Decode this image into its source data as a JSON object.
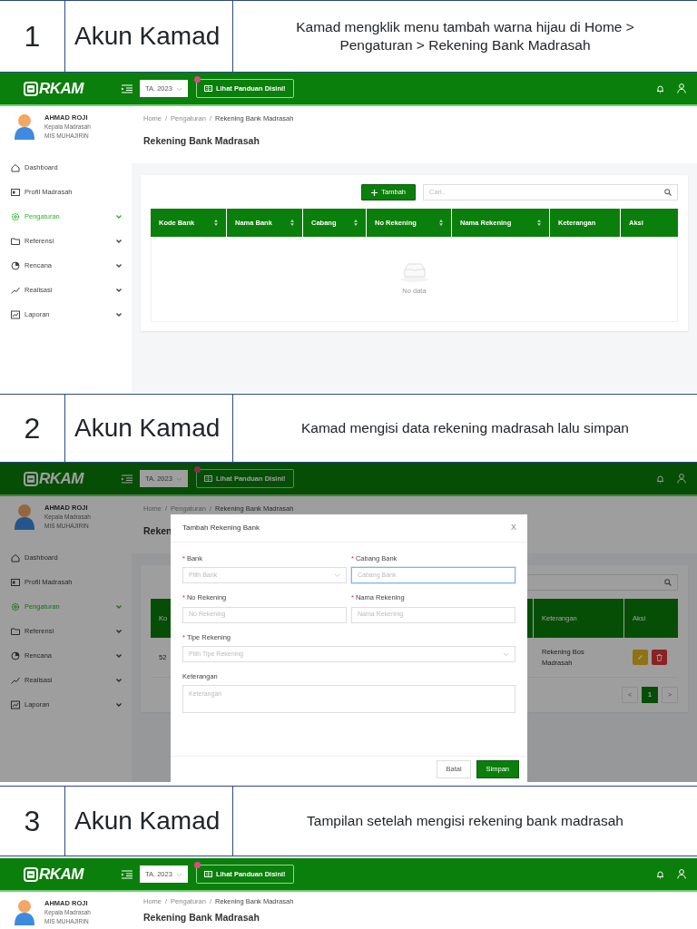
{
  "steps": [
    {
      "number": "1",
      "account": "Akun Kamad",
      "description": "Kamad mengklik menu tambah warna hijau di Home > Pengaturan > Rekening Bank Madrasah",
      "screen": {
        "navbar": {
          "logo": "RKAM",
          "year": "TA. 2023",
          "guide_button": "Lihat Panduan Disini!"
        },
        "user": {
          "name": "AHMAD ROJI",
          "role": "Kepala Madrasah",
          "school": "MIS MUHAJIRIN"
        },
        "sidebar": {
          "items": [
            {
              "label": "Dashboard",
              "selected": false,
              "expandable": false
            },
            {
              "label": "Profil Madrasah",
              "selected": false,
              "expandable": false
            },
            {
              "label": "Pengaturan",
              "selected": true,
              "expandable": true
            },
            {
              "label": "Referensi",
              "selected": false,
              "expandable": true
            },
            {
              "label": "Rencana",
              "selected": false,
              "expandable": true
            },
            {
              "label": "Realisasi",
              "selected": false,
              "expandable": true
            },
            {
              "label": "Laporan",
              "selected": false,
              "expandable": true
            }
          ]
        },
        "breadcrumb": [
          "Home",
          "Pengaturan",
          "Rekening Bank Madrasah"
        ],
        "breadcrumb_separators": [
          "/",
          "/"
        ],
        "page_title": "Rekening Bank Madrasah",
        "content": {
          "kind": "table",
          "add_button": "Tambah",
          "search_placeholder": "Cari..",
          "columns": [
            {
              "label": "Kode Bank",
              "sortable": true
            },
            {
              "label": "Nama Bank",
              "sortable": true
            },
            {
              "label": "Cabang",
              "sortable": true
            },
            {
              "label": "No Rekening",
              "sortable": true
            },
            {
              "label": "Nama Rekening",
              "sortable": true
            },
            {
              "label": "Keterangan",
              "sortable": false
            },
            {
              "label": "Aksi",
              "sortable": false
            }
          ],
          "empty_text": "No data"
        }
      }
    },
    {
      "number": "2",
      "account": "Akun Kamad",
      "description": "Kamad mengisi data rekening madrasah lalu simpan",
      "screen": {
        "navbar": {
          "logo": "RKAM",
          "year": "TA. 2023",
          "guide_button": "Lihat Panduan Disini!"
        },
        "user": {
          "name": "AHMAD ROJI",
          "role": "Kepala Madrasah",
          "school": "MIS MUHAJIRIN"
        },
        "sidebar": {
          "items": [
            {
              "label": "Dashboard",
              "selected": false,
              "expandable": false
            },
            {
              "label": "Profil Madrasah",
              "selected": false,
              "expandable": false
            },
            {
              "label": "Pengaturan",
              "selected": true,
              "expandable": true
            },
            {
              "label": "Referensi",
              "selected": false,
              "expandable": true
            },
            {
              "label": "Rencana",
              "selected": false,
              "expandable": true
            },
            {
              "label": "Realisasi",
              "selected": false,
              "expandable": true
            },
            {
              "label": "Laporan",
              "selected": false,
              "expandable": true
            }
          ]
        },
        "breadcrumb": [
          "Home",
          "Pengaturan",
          "Rekening Bank Madrasah"
        ],
        "breadcrumb_separators": [
          "/",
          "/"
        ],
        "page_title": "Reken",
        "content": {
          "kind": "modal",
          "columns": [
            {
              "label": "Ko"
            },
            {
              "label": "Keterangan"
            },
            {
              "label": "Aksi"
            }
          ],
          "rows": [
            {
              "cells": [
                "52",
                "Rekening Bos Madrasah"
              ],
              "actions": [
                {
                  "kind": "edit"
                },
                {
                  "kind": "delete"
                }
              ]
            }
          ],
          "pagination": [
            {
              "label": "<",
              "selected": false
            },
            {
              "label": "1",
              "selected": true
            },
            {
              "label": ">",
              "selected": false
            }
          ],
          "modal": {
            "title": "Tambah Rekening Bank",
            "close": "X",
            "required_mark": "*",
            "fields": [
              {
                "label": "Bank",
                "required": true,
                "kind": "select",
                "placeholder": "Pilih Bank",
                "focused": false,
                "wide": false
              },
              {
                "label": "Cabang Bank",
                "required": true,
                "kind": "input",
                "placeholder": "Cabang Bank",
                "focused": true,
                "wide": false
              },
              {
                "label": "No Rekening",
                "required": true,
                "kind": "input",
                "placeholder": "No Rekening",
                "focused": false,
                "wide": false
              },
              {
                "label": "Nama Rekening",
                "required": true,
                "kind": "input",
                "placeholder": "Nama Rekening",
                "focused": false,
                "wide": false
              },
              {
                "label": "Tipe Rekening",
                "required": true,
                "kind": "select",
                "placeholder": "Pilih Tipe Rekening",
                "focused": false,
                "wide": true
              },
              {
                "label": "Keterangan",
                "required": false,
                "kind": "textarea",
                "placeholder": "Keterangan",
                "focused": false,
                "wide": true
              }
            ],
            "cancel_button": "Batal",
            "save_button": "Simpan"
          }
        }
      }
    },
    {
      "number": "3",
      "account": "Akun Kamad",
      "description": "Tampilan setelah mengisi rekening bank madrasah",
      "screen": {
        "navbar": {
          "logo": "RKAM",
          "year": "TA. 2023",
          "guide_button": "Lihat Panduan Disini!"
        },
        "user": {
          "name": "AHMAD ROJI",
          "role": "Kepala Madrasah",
          "school": "MIS MUHAJIRIN"
        },
        "breadcrumb": [
          "Home",
          "Pengaturan",
          "Rekening Bank Madrasah"
        ],
        "breadcrumb_separators": [
          "/",
          "/"
        ],
        "page_title": "Rekening Bank Madrasah"
      }
    }
  ]
}
